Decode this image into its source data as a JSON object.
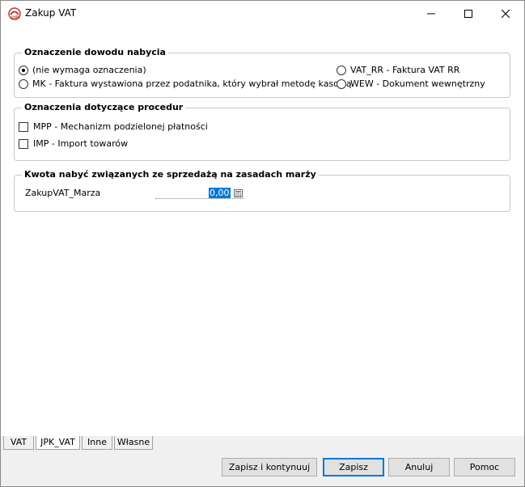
{
  "window": {
    "title": "Zakup VAT",
    "minimize_icon": "minimize-icon",
    "maximize_icon": "maximize-icon",
    "close_icon": "close-icon"
  },
  "groups": {
    "evidence": {
      "legend": "Oznaczenie dowodu nabycia",
      "options": [
        {
          "label": "(nie wymaga oznaczenia)",
          "checked": true
        },
        {
          "label": "MK - Faktura wystawiona przez podatnika, który wybrał metodę kasową",
          "checked": false
        },
        {
          "label": "VAT_RR - Faktura VAT RR",
          "checked": false
        },
        {
          "label": "WEW - Dokument wewnętrzny",
          "checked": false
        }
      ]
    },
    "procedures": {
      "legend": "Oznaczenia dotyczące procedur",
      "options": [
        {
          "label": "MPP - Mechanizm podzielonej płatności",
          "checked": false
        },
        {
          "label": "IMP - Import towarów",
          "checked": false
        }
      ]
    },
    "margin": {
      "legend": "Kwota nabyć związanych ze sprzedażą na zasadach marży",
      "field_label": "ZakupVAT_Marza",
      "field_value": "0,00",
      "calc_icon": "calculator-icon"
    }
  },
  "tabs": [
    {
      "label": "VAT",
      "active": false
    },
    {
      "label": "JPK_VAT",
      "active": true
    },
    {
      "label": "Inne",
      "active": false
    },
    {
      "label": "Własne",
      "active": false
    }
  ],
  "buttons": {
    "save_continue": "Zapisz i kontynuuj",
    "save": "Zapisz",
    "cancel": "Anuluj",
    "help": "Pomoc"
  },
  "colors": {
    "selection": "#0078d7",
    "app_icon": "#c0392b"
  }
}
